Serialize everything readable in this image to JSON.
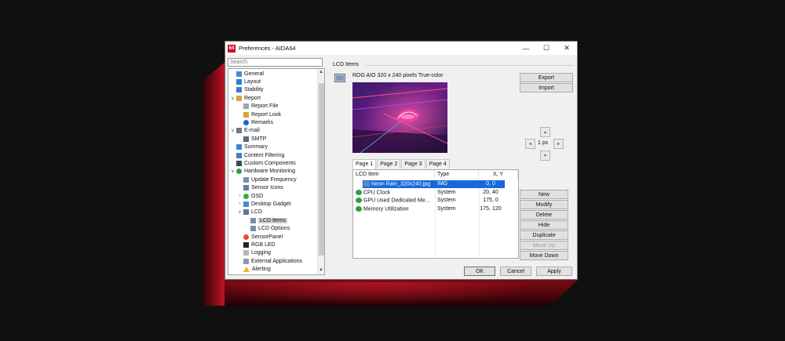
{
  "window": {
    "title": "Preferences - AIDA64",
    "app_icon_text": "64"
  },
  "search": {
    "placeholder": "Search"
  },
  "tree": [
    {
      "label": "General",
      "icon": "general-icon",
      "indent": 0
    },
    {
      "label": "Layout",
      "icon": "layout-icon",
      "indent": 0
    },
    {
      "label": "Stability",
      "icon": "stability-icon",
      "indent": 0
    },
    {
      "label": "Report",
      "icon": "report-icon",
      "indent": 0,
      "expanded": true
    },
    {
      "label": "Report File",
      "icon": "file-icon",
      "indent": 1
    },
    {
      "label": "Report Look",
      "icon": "pencil-icon",
      "indent": 1
    },
    {
      "label": "Remarks",
      "icon": "info-icon",
      "indent": 1
    },
    {
      "label": "E-mail",
      "icon": "email-icon",
      "indent": 0,
      "expanded": true
    },
    {
      "label": "SMTP",
      "icon": "smtp-icon",
      "indent": 1
    },
    {
      "label": "Summary",
      "icon": "summary-icon",
      "indent": 0
    },
    {
      "label": "Content Filtering",
      "icon": "filter-icon",
      "indent": 0
    },
    {
      "label": "Custom Components",
      "icon": "components-icon",
      "indent": 0
    },
    {
      "label": "Hardware Monitoring",
      "icon": "monitoring-icon",
      "indent": 0,
      "expanded": true
    },
    {
      "label": "Update Frequency",
      "icon": "frequency-icon",
      "indent": 1
    },
    {
      "label": "Sensor Icons",
      "icon": "sensor-icon",
      "indent": 1
    },
    {
      "label": "OSD",
      "icon": "osd-icon",
      "indent": 1,
      "collapsed": true
    },
    {
      "label": "Desktop Gadget",
      "icon": "gadget-icon",
      "indent": 1,
      "collapsed": true
    },
    {
      "label": "LCD",
      "icon": "lcd-icon",
      "indent": 1,
      "expanded": true
    },
    {
      "label": "LCD Items",
      "icon": "lcd-items-icon",
      "indent": 2,
      "selected": true
    },
    {
      "label": "LCD Options",
      "icon": "lcd-options-icon",
      "indent": 2
    },
    {
      "label": "SensorPanel",
      "icon": "sensorpanel-icon",
      "indent": 1
    },
    {
      "label": "RGB LED",
      "icon": "rgb-led-icon",
      "indent": 1
    },
    {
      "label": "Logging",
      "icon": "logging-icon",
      "indent": 1
    },
    {
      "label": "External Applications",
      "icon": "external-apps-icon",
      "indent": 1
    },
    {
      "label": "Alerting",
      "icon": "alert-icon",
      "indent": 1
    }
  ],
  "lcd": {
    "section_title": "LCD Items",
    "device_name": "ROG AIO 320 x 240 pixels True-color",
    "export_label": "Export",
    "import_label": "Import",
    "step_label": "1 px",
    "tabs": [
      "Page 1",
      "Page 2",
      "Page 3",
      "Page 4"
    ],
    "columns": [
      "LCD Item",
      "Type",
      "X, Y"
    ],
    "rows": [
      {
        "item": "Neon Rain_320x240.jpg",
        "type": "IMG",
        "xy": "0, 0",
        "icon": "image-icon",
        "selected": true
      },
      {
        "item": "CPU Clock",
        "type": "System",
        "xy": "20, 40",
        "icon": "cpu-icon"
      },
      {
        "item": "GPU Used Dedicated Me...",
        "type": "System",
        "xy": "175, 0",
        "icon": "gpu-icon"
      },
      {
        "item": "Memory Utilization",
        "type": "System",
        "xy": "175, 120",
        "icon": "memory-icon"
      }
    ],
    "side_buttons": {
      "new": "New",
      "modify": "Modify",
      "delete": "Delete",
      "hide": "Hide",
      "duplicate": "Duplicate",
      "move_up": "Move Up",
      "move_down": "Move Down"
    }
  },
  "footer": {
    "ok": "OK",
    "cancel": "Cancel",
    "apply": "Apply"
  },
  "colors": {
    "accent": "#1769d8",
    "brand_red": "#c8102e"
  }
}
